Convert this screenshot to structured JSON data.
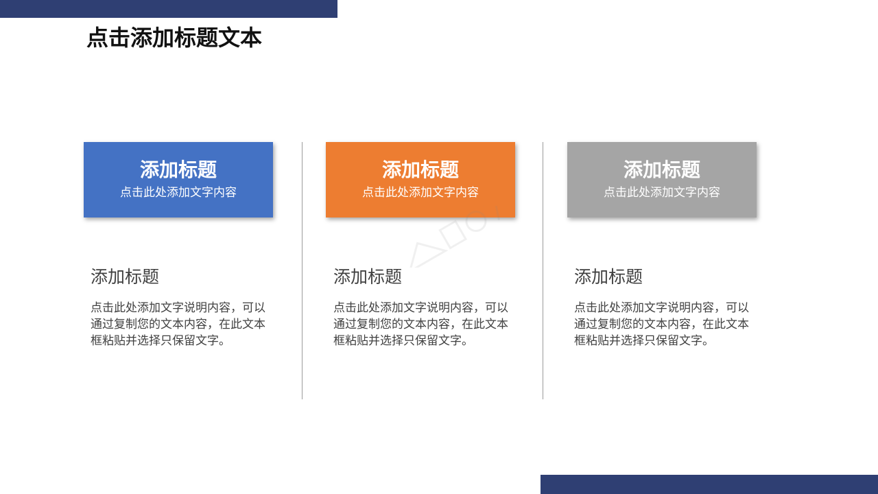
{
  "title": "点击添加标题文本",
  "colors": {
    "navy": "#2f3f73",
    "blue": "#4472c4",
    "orange": "#ed7d31",
    "gray": "#a5a5a5",
    "text_dark": "#404040"
  },
  "cards": [
    {
      "title": "添加标题",
      "subtitle": "点击此处添加文字内容",
      "color": "#4472c4",
      "heading": "添加标题",
      "body": "点击此处添加文字说明内容，可以通过复制您的文本内容，在此文本框粘贴并选择只保留文字。"
    },
    {
      "title": "添加标题",
      "subtitle": "点击此处添加文字内容",
      "color": "#ed7d31",
      "heading": "添加标题",
      "body": "点击此处添加文字说明内容，可以通过复制您的文本内容，在此文本框粘贴并选择只保留文字。"
    },
    {
      "title": "添加标题",
      "subtitle": "点击此处添加文字内容",
      "color": "#a5a5a5",
      "heading": "添加标题",
      "body": "点击此处添加文字说明内容，可以通过复制您的文本内容，在此文本框粘贴并选择只保留文字。"
    }
  ]
}
